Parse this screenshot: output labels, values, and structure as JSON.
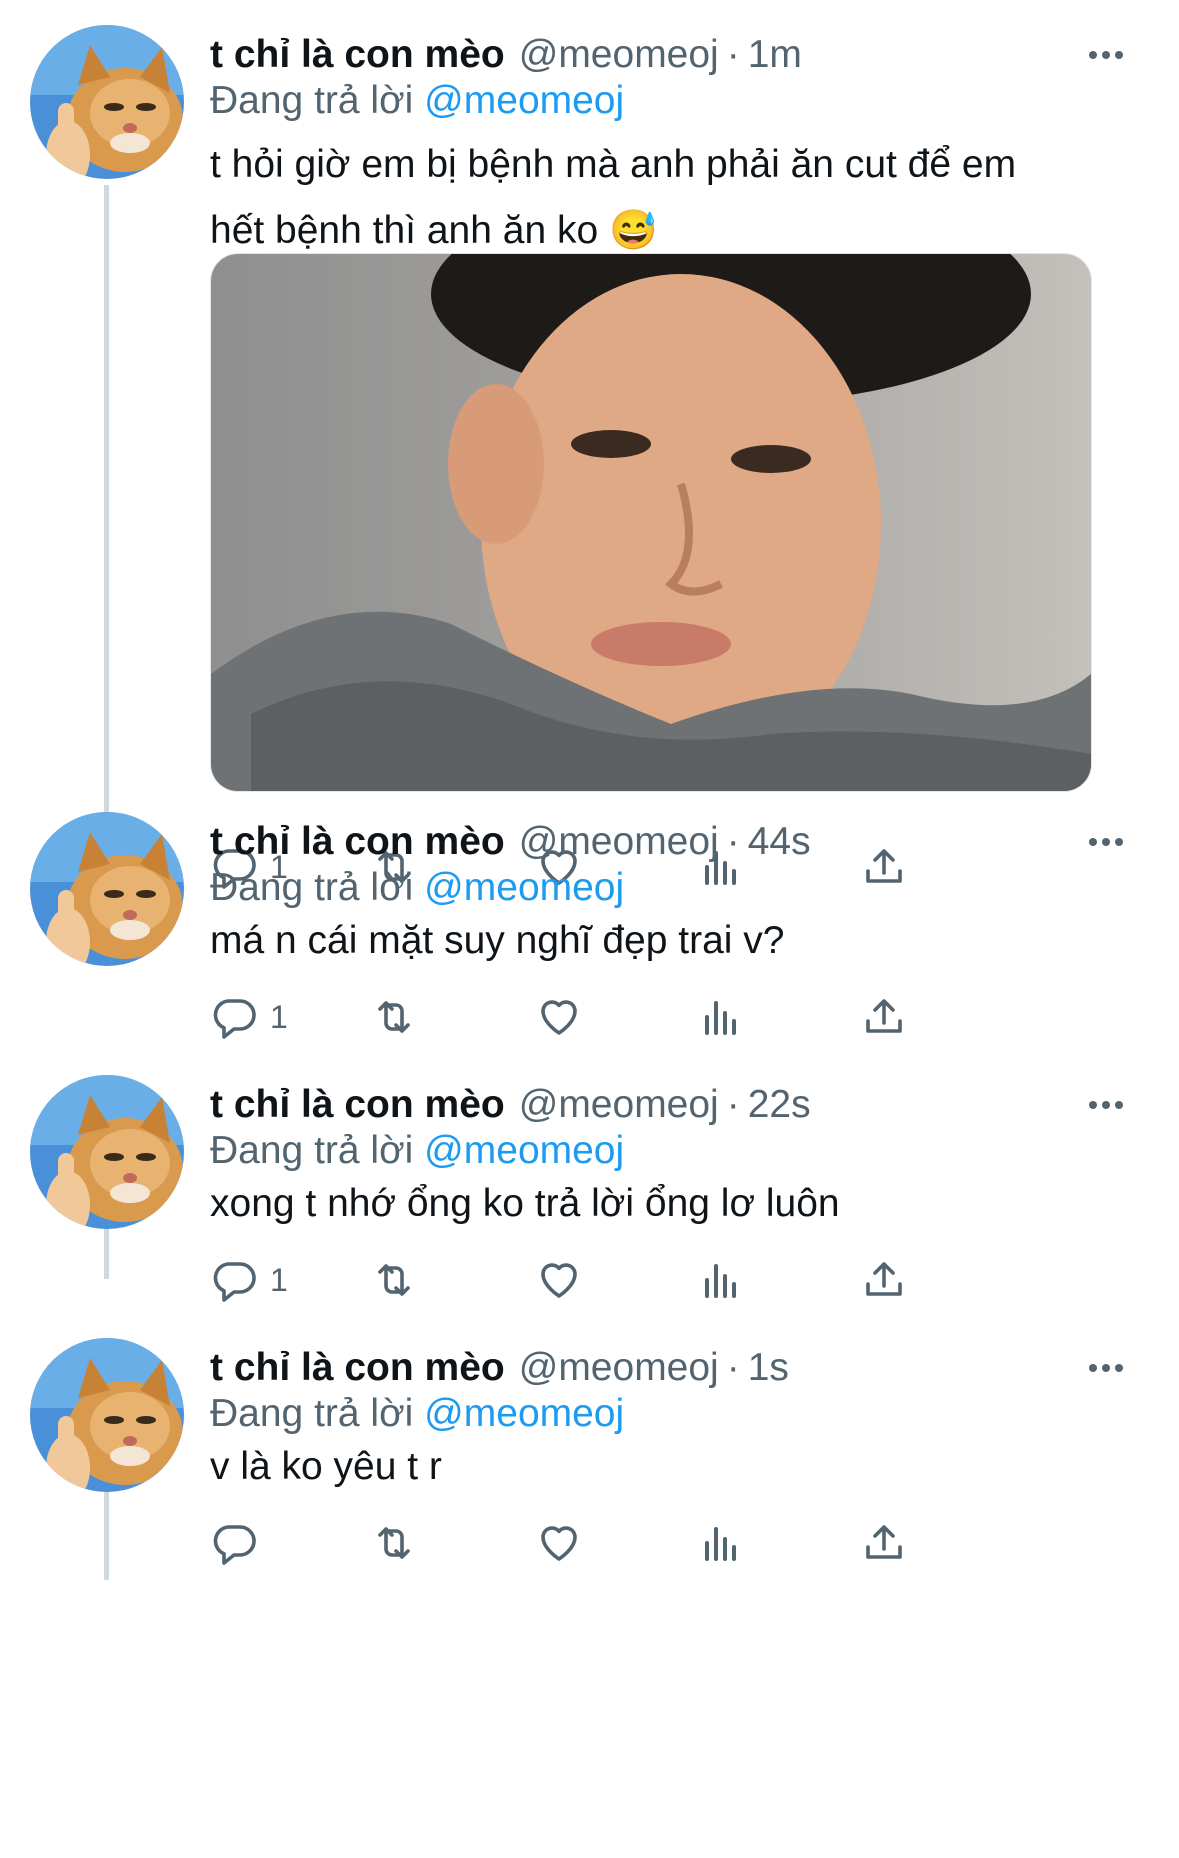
{
  "tweets": [
    {
      "name": "t chỉ là con mèo",
      "handle": "@meomeoj",
      "separator": "·",
      "time": "1m",
      "replying_prefix": "Đang trả lời",
      "replying_to": "@meomeoj",
      "text_line1": "t hỏi giờ em bị bệnh mà anh phải ăn cut để em",
      "text_line2": "hết bệnh thì anh ăn ko 😅",
      "reply_count": "1"
    },
    {
      "name": "t chỉ là con mèo",
      "handle": "@meomeoj",
      "separator": "·",
      "time": "44s",
      "replying_prefix": "Đang trả lời",
      "replying_to": "@meomeoj",
      "text_line1": "má n cái mặt suy nghĩ đẹp trai v?",
      "reply_count": "1"
    },
    {
      "name": "t chỉ là con mèo",
      "handle": "@meomeoj",
      "separator": "·",
      "time": "22s",
      "replying_prefix": "Đang trả lời",
      "replying_to": "@meomeoj",
      "text_line1": "xong t nhớ ổng ko trả lời ổng lơ luôn",
      "reply_count": "1"
    },
    {
      "name": "t chỉ là con mèo",
      "handle": "@meomeoj",
      "separator": "·",
      "time": "1s",
      "replying_prefix": "Đang trả lời",
      "replying_to": "@meomeoj",
      "text_line1": "v là ko yêu t r",
      "reply_count": ""
    }
  ],
  "icons": {
    "reply": "reply-icon",
    "retweet": "retweet-icon",
    "like": "heart-icon",
    "analytics": "analytics-icon",
    "share": "share-icon",
    "more": "more-icon"
  },
  "colors": {
    "mention": "#1d9bf0",
    "secondary_text": "#536471",
    "thread_line": "#cfd9de"
  }
}
